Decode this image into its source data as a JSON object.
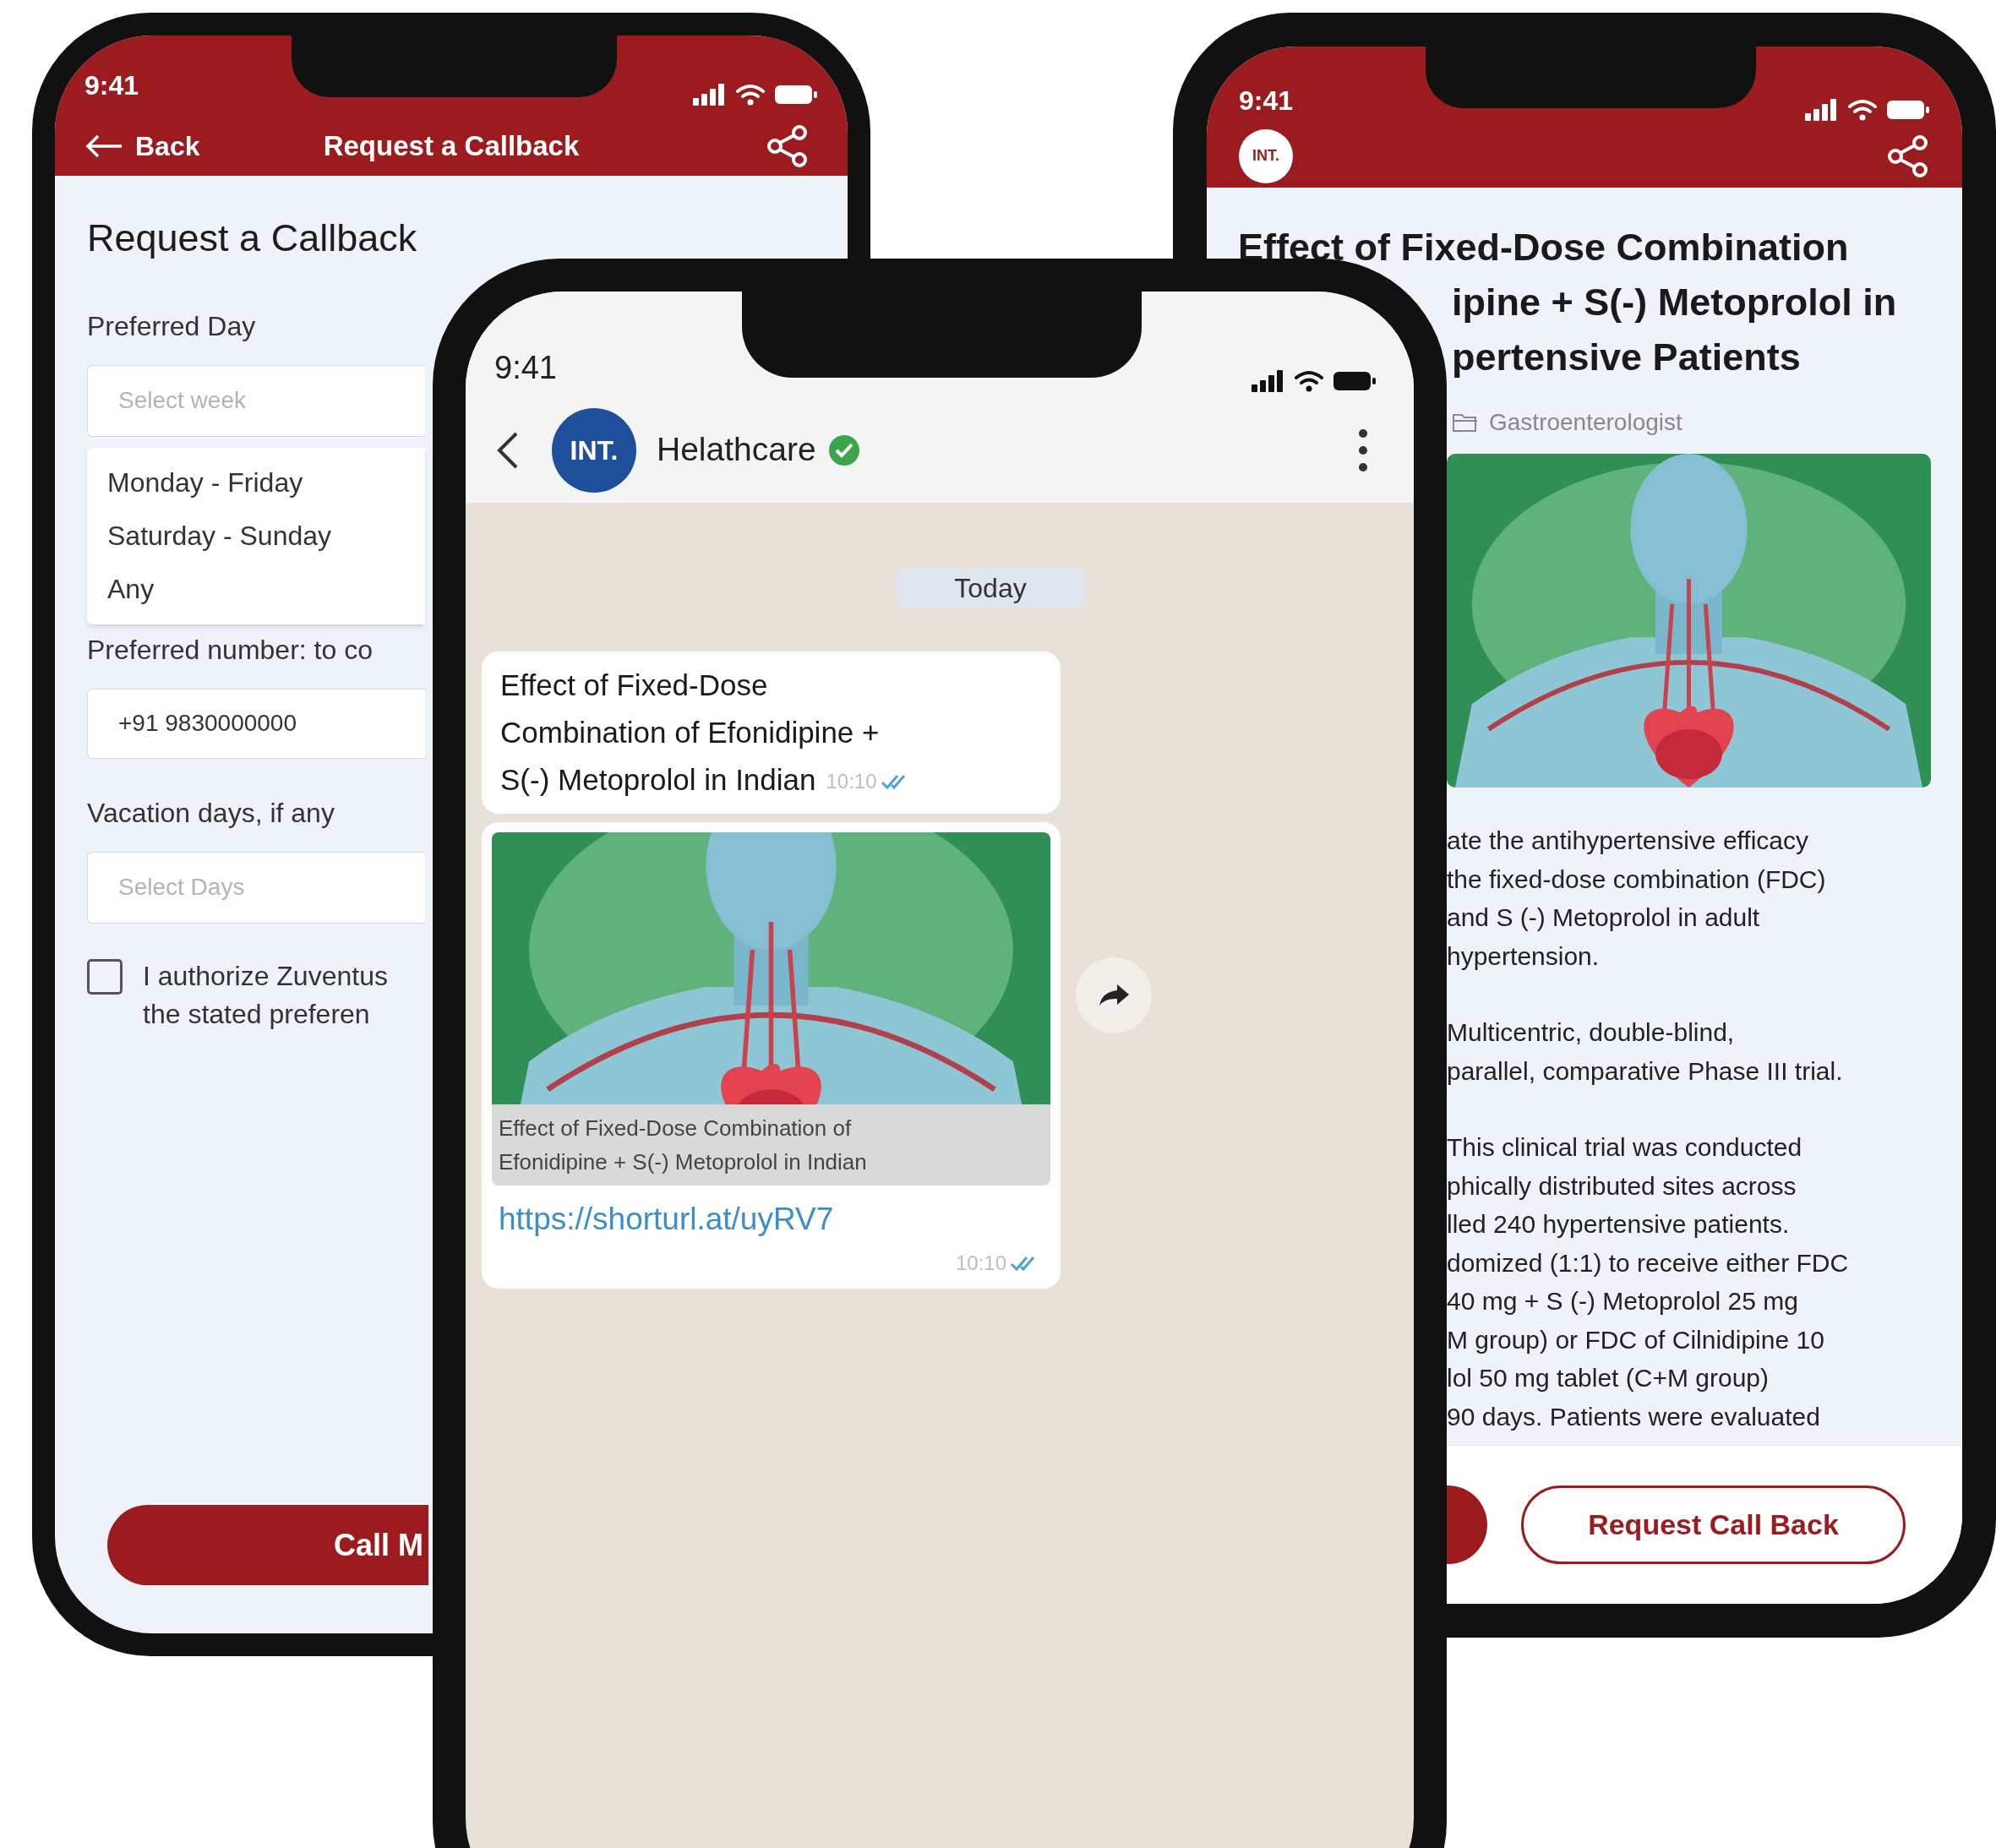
{
  "left_phone": {
    "status_time": "9:41",
    "back": "Back",
    "header_title": "Request a Callback",
    "heading": "Request a Callback",
    "preferred_day": {
      "label": "Preferred Day",
      "placeholder": "Select week"
    },
    "day_options": [
      {
        "label": "Monday - Friday",
        "selected": false
      },
      {
        "label": "Saturday - Sunday",
        "selected": false
      },
      {
        "label": "Any",
        "selected": false
      }
    ],
    "preferred_number": {
      "label": "Preferred number: to co",
      "value": "+91 9830000000"
    },
    "vacation_days": {
      "label": "Vacation days, if any",
      "placeholder": "Select Days"
    },
    "consent": {
      "checked": false,
      "lines": [
        "I authorize Zuventus",
        "the stated preferen"
      ]
    },
    "submit_button": "Call M"
  },
  "right_phone": {
    "status_time": "9:41",
    "logo": "INT.",
    "title_lines": [
      "Effect of Fixed-Dose Combination",
      "ipine + S(-) Metoprolol in",
      "pertensive Patients"
    ],
    "category": "Gastroenterologist",
    "paragraphs": [
      [
        "ate the antihypertensive efficacy",
        "the fixed-dose combination (FDC)",
        "and S (-) Metoprolol in adult",
        "hypertension."
      ],
      [
        "Multicentric, double-blind,",
        "parallel, comparative Phase III trial."
      ],
      [
        "This clinical trial was conducted",
        "phically distributed sites across",
        "lled 240 hypertensive patients.",
        "domized (1:1) to receive either FDC",
        "40 mg + S (-) Metoprolol 25 mg",
        "M group) or FDC of Cilnidipine 10",
        "lol 50 mg tablet (C+M group)",
        "90 days. Patients were evaluated"
      ]
    ],
    "request_button": "Request Call Back"
  },
  "center_phone": {
    "status_time": "9:41",
    "avatar": "INT.",
    "contact": "Helathcare",
    "verified": true,
    "date_chip": "Today",
    "messages": [
      {
        "kind": "text",
        "lines": [
          "Effect of Fixed-Dose",
          "Combination of Efonidipine +",
          "S(-) Metoprolol in Indian"
        ],
        "time": "10:10",
        "read": true
      },
      {
        "kind": "link_preview",
        "caption_lines": [
          "Effect of Fixed-Dose Combination of",
          "Efonidipine + S(-) Metoprolol in Indian"
        ],
        "link": "https://shorturl.at/uyRV7",
        "time": "10:10",
        "read": true
      }
    ]
  }
}
